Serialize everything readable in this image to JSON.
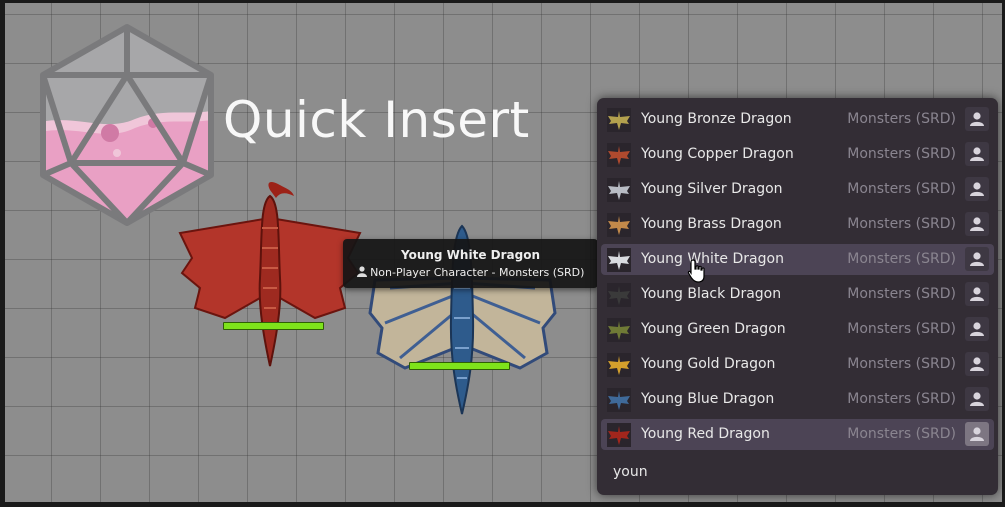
{
  "logo": {
    "text": "Quick Insert"
  },
  "tooltip": {
    "title": "Young White Dragon",
    "subtitle": "Non-Player Character - Monsters (SRD)",
    "icon": "user-icon"
  },
  "tokens": [
    {
      "name": "red-dragon-token",
      "hp_fraction": 1.0
    },
    {
      "name": "white-dragon-token",
      "hp_fraction": 1.0
    }
  ],
  "quick_insert": {
    "results": [
      {
        "name": "Young Bronze Dragon",
        "source": "Monsters (SRD)",
        "color": "#b3a14e"
      },
      {
        "name": "Young Copper Dragon",
        "source": "Monsters (SRD)",
        "color": "#b04a2e"
      },
      {
        "name": "Young Silver Dragon",
        "source": "Monsters (SRD)",
        "color": "#b8bcc4"
      },
      {
        "name": "Young Brass Dragon",
        "source": "Monsters (SRD)",
        "color": "#c2894a"
      },
      {
        "name": "Young White Dragon",
        "source": "Monsters (SRD)",
        "color": "#d9dbe0"
      },
      {
        "name": "Young Black Dragon",
        "source": "Monsters (SRD)",
        "color": "#3a3a3a"
      },
      {
        "name": "Young Green Dragon",
        "source": "Monsters (SRD)",
        "color": "#6f7a36"
      },
      {
        "name": "Young Gold Dragon",
        "source": "Monsters (SRD)",
        "color": "#d4a02c"
      },
      {
        "name": "Young Blue Dragon",
        "source": "Monsters (SRD)",
        "color": "#3f6a9a"
      },
      {
        "name": "Young Red Dragon",
        "source": "Monsters (SRD)",
        "color": "#a3261c"
      }
    ],
    "hovered_index": 4,
    "selected_index": 9,
    "query": "youn"
  }
}
